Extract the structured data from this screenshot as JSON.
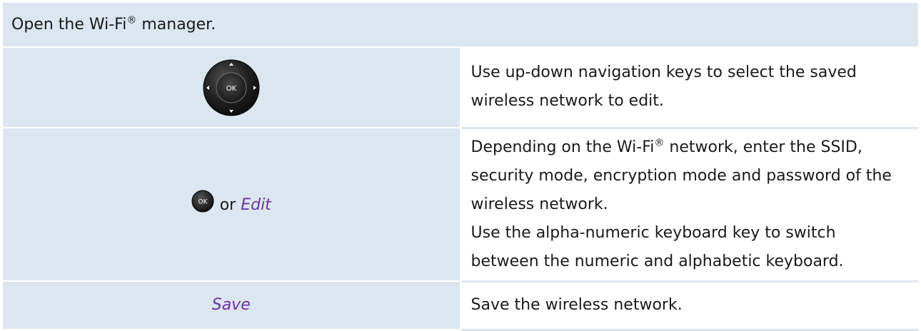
{
  "header": {
    "text_before": "Open the Wi-Fi",
    "registered_mark": "®",
    "text_after": " manager."
  },
  "rows": [
    {
      "icon": "navigation-key-icon",
      "lines": [
        "Use up-down navigation keys to select the saved wireless network to edit."
      ]
    },
    {
      "icon": "ok-key-icon",
      "key_label": "OK",
      "connector": "or",
      "softkey": "Edit",
      "line1_before": "Depending on the Wi-Fi",
      "registered_mark": "®",
      "line1_after": " network, enter the SSID, security mode, encryption mode and password of the wireless network.",
      "line2": "Use the alpha-numeric keyboard key to switch between the numeric and alphabetic keyboard."
    },
    {
      "softkey": "Save",
      "lines": [
        "Save the wireless network."
      ]
    }
  ],
  "nav_key_label": "OK",
  "colors": {
    "table_shade": "#dce6f1",
    "softkey": "#7030a0",
    "key_body": "#1f1f1f"
  }
}
